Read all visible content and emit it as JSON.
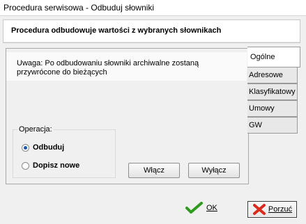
{
  "window": {
    "title": "Procedura serwisowa - Odbuduj słowniki"
  },
  "header": {
    "text": "Procedura odbudowuje wartości z wybranych słownikach"
  },
  "note": {
    "text": "Uwaga: Po odbudowaniu słowniki archiwalne zostaną przywrócone do bieżących"
  },
  "operation": {
    "legend": "Operacja:",
    "options": [
      {
        "label": "Odbuduj",
        "selected": true
      },
      {
        "label": "Dopisz nowe",
        "selected": false
      }
    ]
  },
  "buttons": {
    "enable": "Włącz",
    "disable": "Wyłącz"
  },
  "tabs": [
    "Ogólne",
    "Adresowe",
    "Klasyfikatowy",
    "Umowy",
    "GW"
  ],
  "footer": {
    "ok": "OK",
    "cancel": "Porzuć"
  },
  "colors": {
    "ok_icon": "#2e9a1e",
    "cancel_icon": "#d92a1c",
    "radio_dot": "#1f56a8"
  }
}
